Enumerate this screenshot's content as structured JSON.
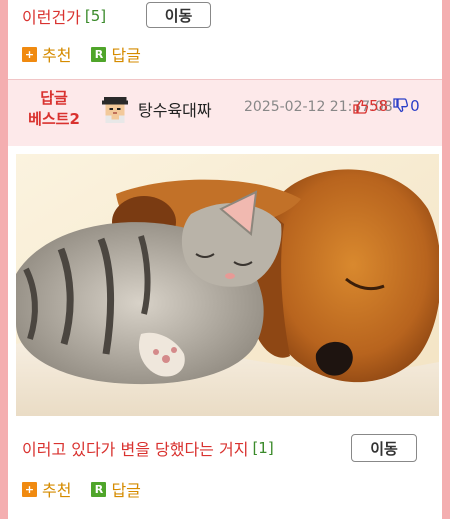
{
  "post1": {
    "title": "이런건가",
    "reply_count": "[5]",
    "move_label": "이동"
  },
  "actions1": {
    "recommend_label": "추천",
    "reply_label": "답글"
  },
  "best": {
    "label_line1": "답글",
    "label_line2": "베스트2",
    "author": "탕수육대짜",
    "datetime": "2025-02-12 21:37:08",
    "upvotes": "58",
    "downvotes": "0"
  },
  "post2": {
    "title": "이러고 있다가 변을 당했다는 거지",
    "reply_count": "[1]",
    "move_label": "이동"
  },
  "actions2": {
    "recommend_label": "추천",
    "reply_label": "답글"
  },
  "icons": {
    "recommend": "plus-square-icon",
    "reply": "r-square-icon",
    "up": "thumbs-up-icon",
    "down": "thumbs-down-icon"
  },
  "colors": {
    "accent_red": "#d9322f",
    "count_green": "#3a8a2a",
    "action_orange": "#d58b00",
    "border_pink": "#f4aeb0",
    "best_bg": "#fde9ea"
  }
}
